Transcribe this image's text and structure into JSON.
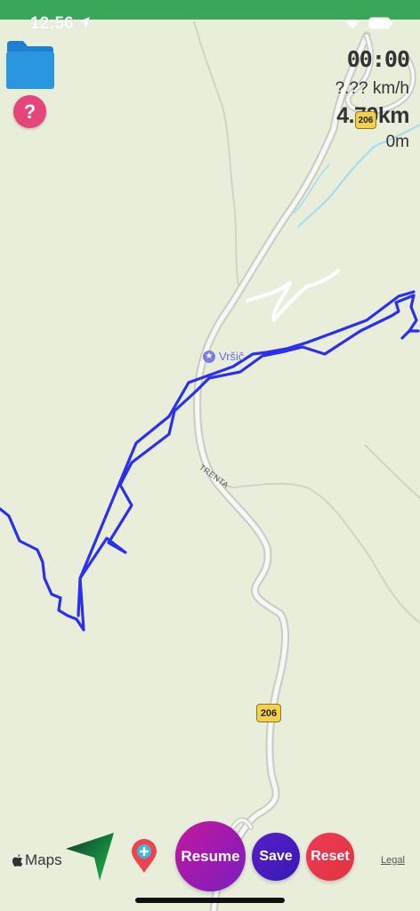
{
  "status": {
    "time": "12:56"
  },
  "stats": {
    "elapsed": "00:00",
    "speed": "?.?? km/h",
    "distance": "4.70km",
    "elevation": "0m"
  },
  "map": {
    "poi_label": "Vršič",
    "street_label": "TRENTA",
    "road_shield": "206",
    "road_shield_top": "206",
    "attribution": "Maps",
    "legal": "Legal"
  },
  "controls": {
    "help": "?",
    "resume": "Resume",
    "save": "Save",
    "reset": "Reset"
  },
  "colors": {
    "track": "#2b2ff0",
    "statusbar": "#3aa65a",
    "map_bg": "#e9eedb"
  }
}
